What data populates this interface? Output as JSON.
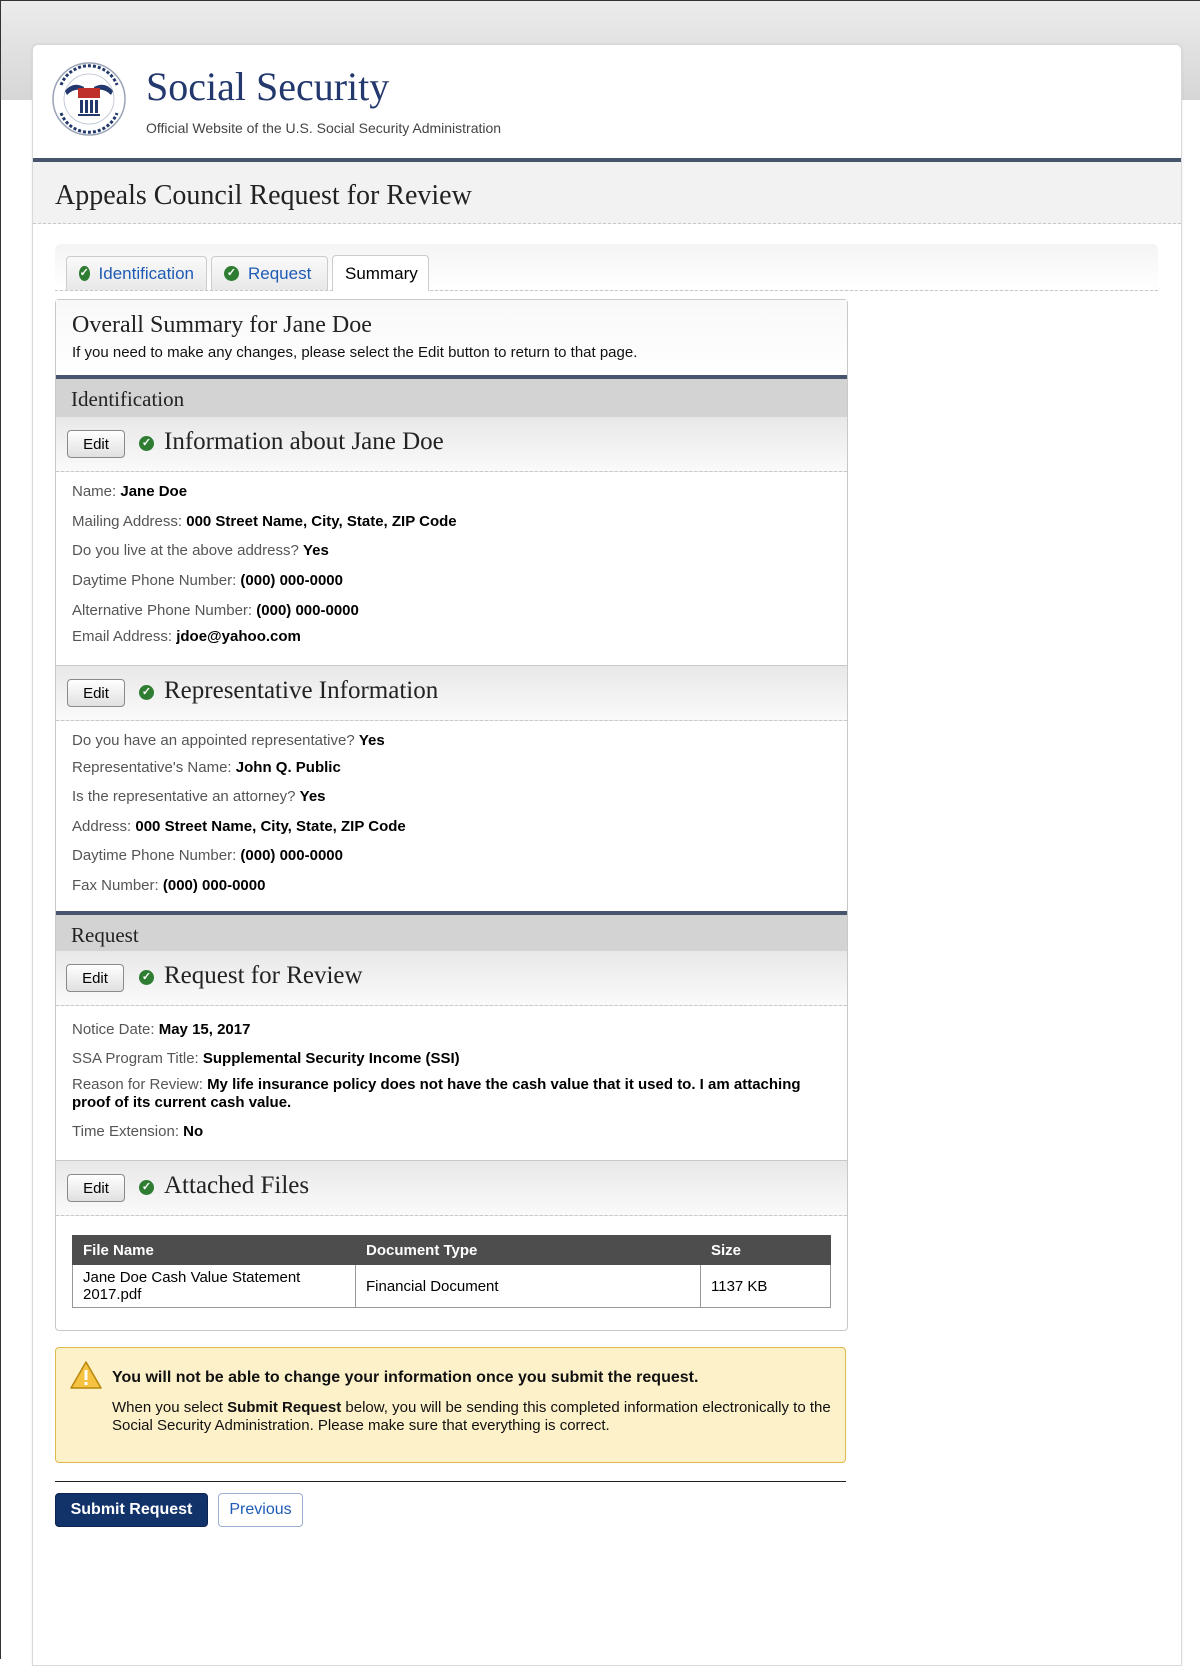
{
  "site": {
    "title": "Social Security",
    "subtitle": "Official Website of the U.S. Social Security Administration",
    "seal_text": "SOCIAL SECURITY ADMINISTRATION USA"
  },
  "page_title": "Appeals Council Request for Review",
  "tabs": [
    {
      "label": "Identification",
      "complete": true
    },
    {
      "label": "Request",
      "complete": true
    },
    {
      "label": "Summary",
      "active": true
    }
  ],
  "summary": {
    "title": "Overall Summary for Jane Doe",
    "subtitle": "If you need to make any changes, please select the Edit button to return to that page.",
    "edit_label": "Edit",
    "identification_section": "Identification",
    "request_section": "Request",
    "info": {
      "heading": "Information about Jane Doe",
      "fields": [
        {
          "label": "Name: ",
          "value": "Jane Doe"
        },
        {
          "label": "Mailing Address: ",
          "value": "000 Street Name, City, State, ZIP Code"
        },
        {
          "label": "Do you live at the above address? ",
          "value": "Yes"
        },
        {
          "label": "Daytime Phone Number: ",
          "value": "(000) 000-0000"
        },
        {
          "label": "Alternative Phone Number: ",
          "value": "(000) 000-0000"
        },
        {
          "label": "Email Address: ",
          "value": "jdoe@yahoo.com"
        }
      ]
    },
    "representative": {
      "heading": "Representative Information",
      "fields": [
        {
          "label": "Do you have an appointed representative? ",
          "value": "Yes"
        },
        {
          "label": "Representative's Name: ",
          "value": "John Q. Public"
        },
        {
          "label": "Is the representative an attorney? ",
          "value": "Yes"
        },
        {
          "label": "Address: ",
          "value": "000 Street Name, City, State, ZIP Code"
        },
        {
          "label": "Daytime Phone Number: ",
          "value": "(000) 000-0000"
        },
        {
          "label": "Fax Number: ",
          "value": "(000) 000-0000"
        }
      ]
    },
    "review": {
      "heading": "Request for Review",
      "fields": [
        {
          "label": "Notice Date: ",
          "value": "May 15, 2017"
        },
        {
          "label": "SSA Program Title: ",
          "value": "Supplemental Security Income (SSI)"
        },
        {
          "label": "Reason for Review: ",
          "value": "My life insurance policy does not have the cash value that it used to. I am attaching proof of its current cash value."
        },
        {
          "label": "Time Extension: ",
          "value": "No"
        }
      ]
    },
    "files": {
      "heading": "Attached Files",
      "columns": [
        "File Name",
        "Document Type",
        "Size"
      ],
      "rows": [
        [
          "Jane Doe Cash Value Statement 2017.pdf",
          "Financial Document",
          "1137 KB"
        ]
      ]
    }
  },
  "warning": {
    "title": "You will not be able to change your information once you submit the request.",
    "body_pre": "When you select ",
    "body_bold": "Submit Request",
    "body_post": " below, you will be sending this completed information electronically to the Social Security Administration. Please make sure that everything is correct."
  },
  "buttons": {
    "submit": "Submit Request",
    "previous": "Previous"
  },
  "colors": {
    "brand_navy": "#23386c",
    "rule": "#46546e",
    "success": "#2e7d32",
    "link": "#1f5bb5",
    "warning_bg": "#fcf1c9",
    "submit_bg": "#12336a"
  }
}
